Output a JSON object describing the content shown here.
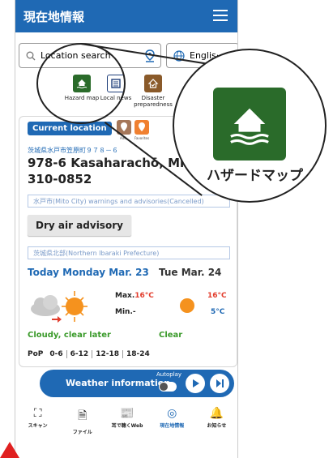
{
  "header": {
    "title": "現在地情報"
  },
  "search": {
    "placeholder": "Location search"
  },
  "language": {
    "selected": "Englis···"
  },
  "quick_links": [
    {
      "label": "Hazard map",
      "icon": "house-flood-icon"
    },
    {
      "label": "Local news",
      "icon": "newspaper-icon"
    },
    {
      "label": "Disaster preparedness",
      "icon": "home-check-icon"
    }
  ],
  "location": {
    "badge": "Current location",
    "mini_buttons": [
      {
        "label": "Add"
      },
      {
        "label": "Favorites"
      }
    ],
    "address_kana": "茨城県水戸市笠原町９７８－６",
    "address": "978-6 Kasaharachō, Mito, Ib",
    "postal": "310-0852"
  },
  "warnings": {
    "city_box": "水戸市(Mito City) warnings and advisories(Cancelled)",
    "advisory": "Dry air advisory",
    "region_box": "茨城県北部(Northern Ibaraki Prefecture)"
  },
  "forecast": {
    "today": {
      "title": "Today Monday Mar. 23",
      "max_label": "Max.",
      "max": "16°C",
      "min_label": "Min.",
      "min": "-",
      "condition": "Cloudy, clear later"
    },
    "tomorrow": {
      "title": "Tue Mar. 24",
      "max": "16°C",
      "min": "5°C",
      "condition": "Clear"
    },
    "pop": {
      "label": "PoP",
      "periods": [
        "0-6",
        "6-12",
        "12-18",
        "18-24"
      ]
    }
  },
  "weather_bar": {
    "label": "Weather information",
    "autoplay": "Autoplay"
  },
  "tabs": [
    {
      "label": "スキャン",
      "glyph": "⛶"
    },
    {
      "label": "ファイル",
      "glyph": "🗎"
    },
    {
      "label": "耳で聴くWeb",
      "glyph": "📰"
    },
    {
      "label": "現在地情報",
      "glyph": "◎"
    },
    {
      "label": "お知らせ",
      "glyph": "🔔"
    }
  ],
  "magnifier": {
    "label": "ハザードマップ",
    "icon": "house-flood-icon"
  },
  "colors": {
    "primary": "#1f69b4",
    "hazard_green": "#2a6b2a",
    "sun_orange": "#f5921e",
    "temp_red": "#e23d2d",
    "condition_green": "#3a9a2a"
  }
}
